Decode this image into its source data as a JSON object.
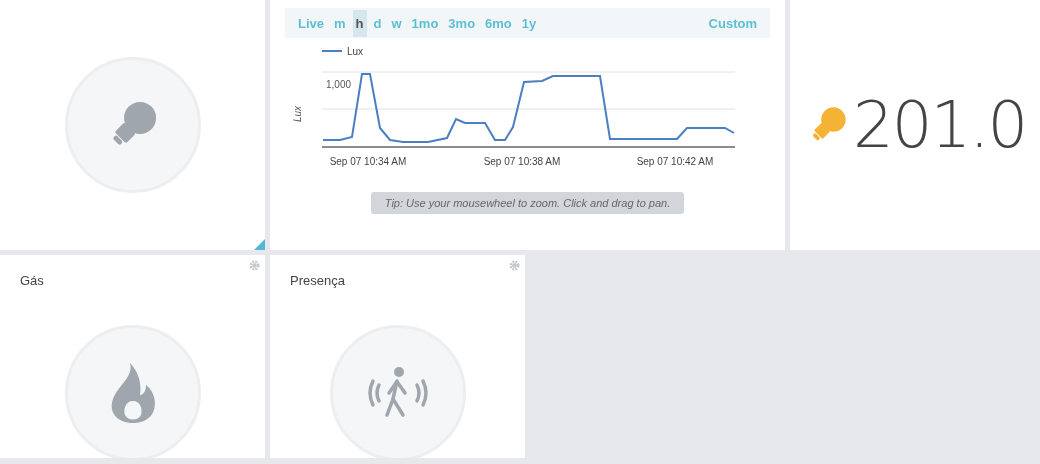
{
  "tiles": [
    {
      "kind": "bulb",
      "resizable": true
    },
    {
      "kind": "chart",
      "ranges": [
        {
          "label": "Live",
          "selected": false
        },
        {
          "label": "m",
          "selected": false
        },
        {
          "label": "h",
          "selected": true
        },
        {
          "label": "d",
          "selected": false
        },
        {
          "label": "w",
          "selected": false
        },
        {
          "label": "1mo",
          "selected": false
        },
        {
          "label": "3mo",
          "selected": false
        },
        {
          "label": "6mo",
          "selected": false
        },
        {
          "label": "1y",
          "selected": false
        }
      ],
      "custom": "Custom",
      "chart": {
        "legend": "Lux",
        "ylabel": "Lux",
        "ytick": "1,000",
        "xlabels": [
          "Sep 07 10:34 AM",
          "Sep 07 10:38 AM",
          "Sep 07 10:42 AM"
        ]
      },
      "tip": "Tip: Use your mousewheel to zoom. Click and drag to pan."
    },
    {
      "kind": "value",
      "value": "201.0"
    },
    {
      "kind": "flame",
      "title": "Gás"
    },
    {
      "kind": "walker",
      "title": "Presença"
    }
  ]
}
